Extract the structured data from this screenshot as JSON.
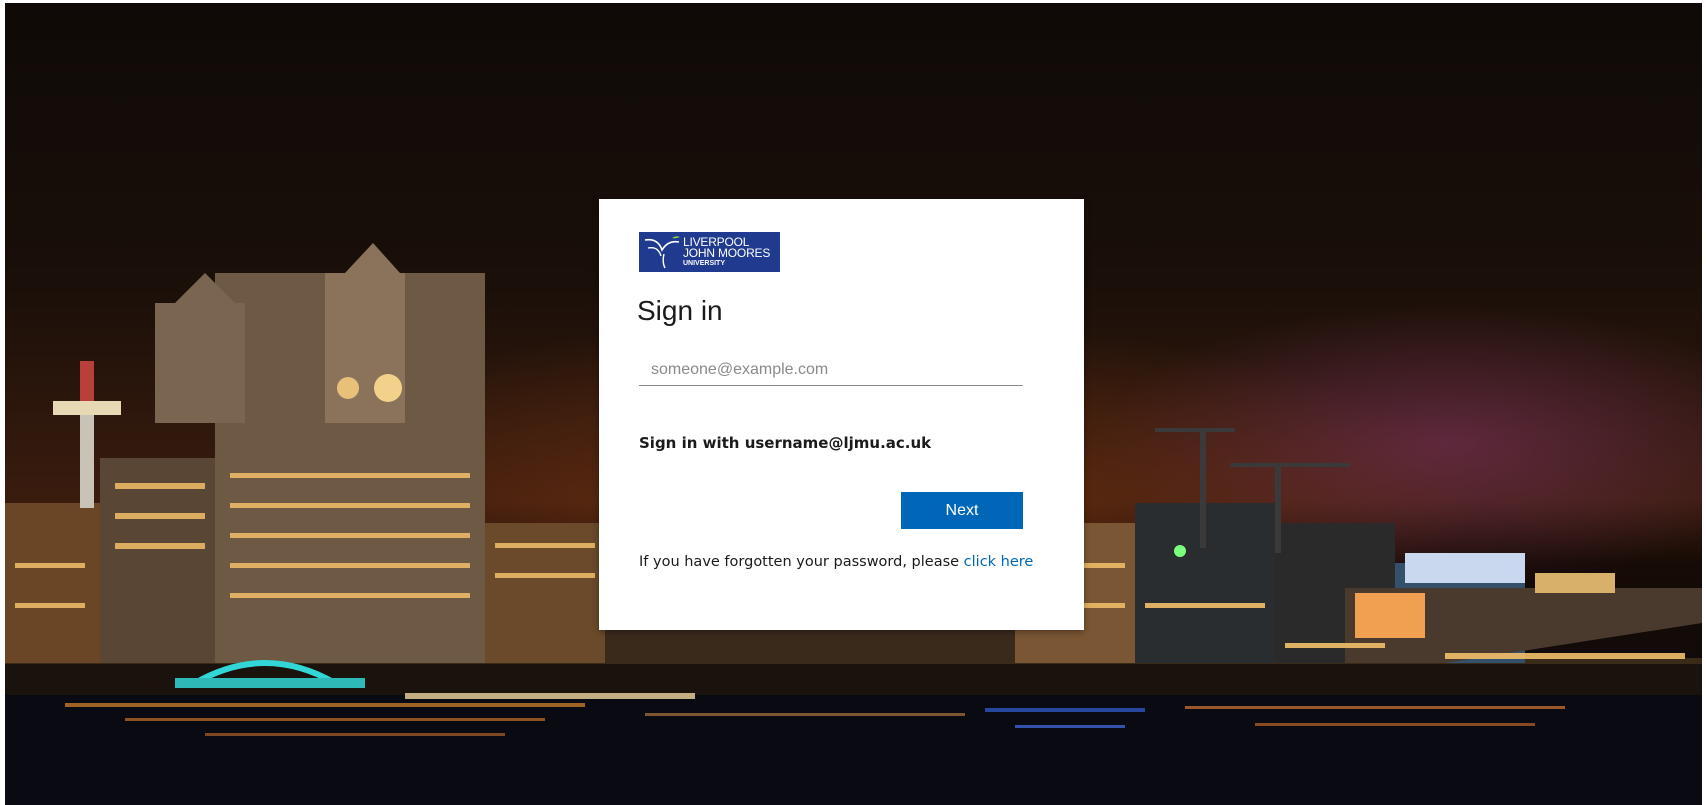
{
  "background": {
    "description_icon": "liverpool-waterfront-night-photo"
  },
  "logo": {
    "line1": "LIVERPOOL",
    "line2": "JOHN MOORES",
    "line3": "UNIVERSITY",
    "color": "#1f3a8f"
  },
  "signin": {
    "title": "Sign in",
    "email_placeholder": "someone@example.com",
    "email_value": "",
    "hint": "Sign in with username@ljmu.ac.uk",
    "next_label": "Next",
    "forgot_text": "If you have forgotten your password, please",
    "forgot_link": "click here",
    "accent": "#0067b8"
  }
}
